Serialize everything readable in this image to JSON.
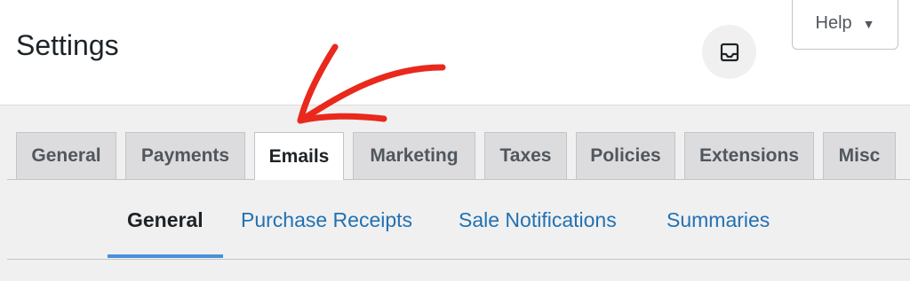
{
  "header": {
    "title": "Settings",
    "inbox_icon": "inbox-icon",
    "help_label": "Help",
    "help_caret": "▼"
  },
  "tabs": [
    {
      "label": "General"
    },
    {
      "label": "Payments"
    },
    {
      "label": "Emails",
      "active": true
    },
    {
      "label": "Marketing"
    },
    {
      "label": "Taxes"
    },
    {
      "label": "Policies"
    },
    {
      "label": "Extensions"
    },
    {
      "label": "Misc"
    }
  ],
  "subnav": [
    {
      "label": "General",
      "current": true
    },
    {
      "label": "Purchase Receipts"
    },
    {
      "label": "Sale Notifications"
    },
    {
      "label": "Summaries"
    }
  ],
  "colors": {
    "link": "#2271b1",
    "annotation_arrow": "#e8291c",
    "underline": "#4a90d9"
  }
}
